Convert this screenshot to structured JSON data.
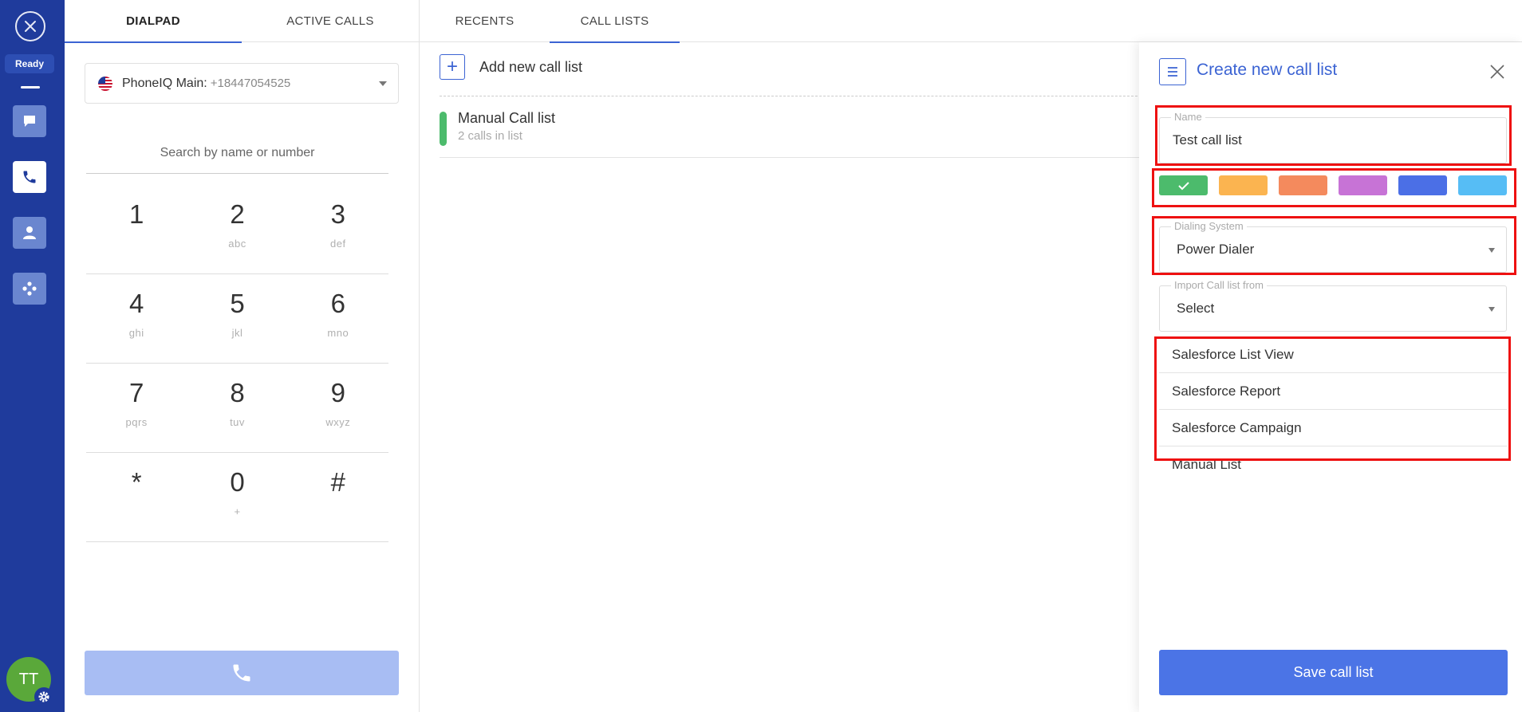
{
  "status": {
    "ready_label": "Ready"
  },
  "user": {
    "initials": "TT"
  },
  "tabs": [
    {
      "label": "DIALPAD"
    },
    {
      "label": "ACTIVE CALLS"
    },
    {
      "label": "RECENTS"
    },
    {
      "label": "CALL LISTS"
    }
  ],
  "dialpad": {
    "line_name": "PhoneIQ Main:",
    "line_number": "+18447054525",
    "search_placeholder": "Search by name or number",
    "keys": [
      {
        "digit": "1",
        "letters": ""
      },
      {
        "digit": "2",
        "letters": "abc"
      },
      {
        "digit": "3",
        "letters": "def"
      },
      {
        "digit": "4",
        "letters": "ghi"
      },
      {
        "digit": "5",
        "letters": "jkl"
      },
      {
        "digit": "6",
        "letters": "mno"
      },
      {
        "digit": "7",
        "letters": "pqrs"
      },
      {
        "digit": "8",
        "letters": "tuv"
      },
      {
        "digit": "9",
        "letters": "wxyz"
      },
      {
        "digit": "*",
        "letters": ""
      },
      {
        "digit": "0",
        "letters": "+"
      },
      {
        "digit": "#",
        "letters": ""
      }
    ]
  },
  "call_lists": {
    "add_label": "Add new call list",
    "items": [
      {
        "title": "Manual Call list",
        "subtitle": "2 calls in list",
        "color": "#4cbb6c"
      }
    ]
  },
  "drawer": {
    "title": "Create new call list",
    "name_label": "Name",
    "name_value": "Test call list",
    "colors": [
      "#4cbb6c",
      "#fbb450",
      "#f48a5d",
      "#c773d6",
      "#4b6fe6",
      "#56bdf5"
    ],
    "selected_color_index": 0,
    "dialing_label": "Dialing System",
    "dialing_value": "Power Dialer",
    "import_label": "Import Call list from",
    "import_value": "Select",
    "import_options": [
      {
        "label": "Salesforce List View"
      },
      {
        "label": "Salesforce Report"
      },
      {
        "label": "Salesforce Campaign"
      },
      {
        "label": "Manual List"
      }
    ],
    "save_label": "Save call list"
  },
  "theme": {
    "accent": "#3b63d3",
    "rail": "#1f3b9c",
    "highlight": "#ee1111"
  }
}
